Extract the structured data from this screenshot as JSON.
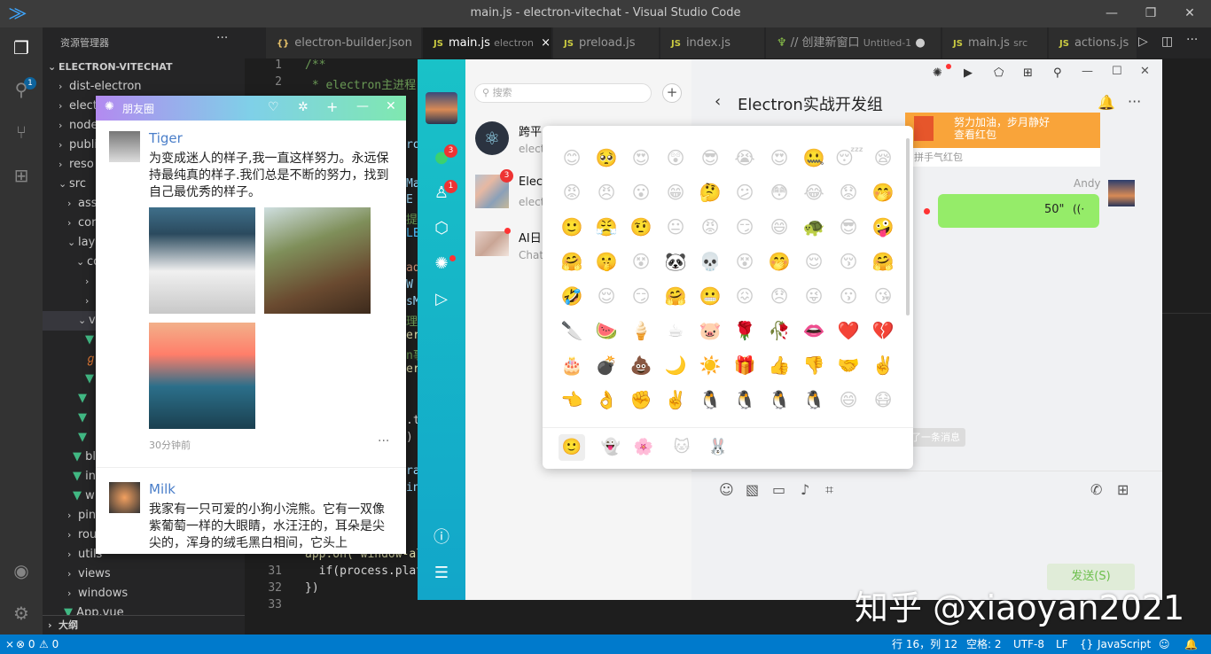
{
  "window": {
    "title": "main.js - electron-vitechat - Visual Studio Code"
  },
  "explorer": {
    "header": "资源管理器",
    "more": "···",
    "project": "ELECTRON-VITECHAT",
    "items": [
      "dist-electron",
      "elect",
      "node",
      "publi",
      "reso",
      "src",
      "ass",
      "cor",
      "layo",
      "co",
      "w",
      "s",
      "v",
      "bl",
      "in",
      "w",
      "pin",
      "rou",
      "utils",
      "views",
      "windows",
      "App.vue"
    ],
    "outline": "大纲"
  },
  "activity": {
    "badge": "1"
  },
  "tabs": [
    {
      "icon": "{}",
      "label": "electron-builder.json",
      "sub": ""
    },
    {
      "icon": "JS",
      "label": "main.js",
      "sub": "electron",
      "close": "×"
    },
    {
      "icon": "JS",
      "label": "preload.js",
      "sub": ""
    },
    {
      "icon": "JS",
      "label": "index.js",
      "sub": ""
    },
    {
      "icon": "",
      "label": "// 创建新窗口",
      "sub": "Untitled-1"
    },
    {
      "icon": "JS",
      "label": "main.js",
      "sub": "src"
    },
    {
      "icon": "JS",
      "label": "actions.js",
      "sub": ""
    }
  ],
  "code": {
    "lines": [
      {
        "n": "1",
        "t": "/**"
      },
      {
        "n": "2",
        "t": " * electron主进程"
      },
      {
        "n": "31",
        "t": "  if(process.plat"
      },
      {
        "n": "32",
        "t": "})"
      },
      {
        "n": "33",
        "t": ""
      }
    ],
    "fragments": [
      "app.on('window-al",
      "ro",
      "Ma",
      "E",
      "提示",
      "LEC",
      "ado",
      "W",
      "sM",
      "理",
      "er",
      "n事",
      "er(",
      ".t",
      ")",
      "ra",
      "in"
    ]
  },
  "status": {
    "errors": "0",
    "warnings": "0",
    "position": "行 16，列 12",
    "spaces": "空格: 2",
    "encoding": "UTF-8",
    "eol": "LF",
    "language": "JavaScript"
  },
  "moments": {
    "title": "朋友圈",
    "posts": [
      {
        "name": "Tiger",
        "text": "为变成迷人的样子,我一直这样努力。永远保持最纯真的样子.我们总是不断的努力，找到自己最优秀的样子。",
        "time": "30分钟前",
        "more": "···"
      },
      {
        "name": "Milk",
        "text": "我家有一只可爱的小狗小浣熊。它有一双像紫葡萄一样的大眼睛，水汪汪的，耳朵是尖尖的，浑身的绒毛黑白相间，它头上"
      }
    ]
  },
  "chat": {
    "search_placeholder": "搜索",
    "add": "+",
    "nav_badges": [
      "3",
      "1"
    ],
    "conversations": [
      {
        "name": "跨平",
        "preview": "elect",
        "badge": ""
      },
      {
        "name": "Elec",
        "preview": "elect",
        "badge": "3"
      },
      {
        "name": "AI日",
        "preview": "Chat",
        "badge": ""
      }
    ],
    "title": "Electron实战开发组",
    "redpacket_text": "努力加油，步月静好",
    "redpacket_link": "查看红包",
    "redpacket_footer": "拼手气红包",
    "sender": "Andy",
    "voice_duration": "50\"",
    "recall_notice": "撤回了一条消息",
    "send_button": "发送(S)"
  },
  "emoji": {
    "grid": [
      "😊",
      "🥺",
      "😍",
      "😲",
      "😎",
      "😭",
      "😍",
      "🤐",
      "😴",
      "😪",
      "😡",
      "😠",
      "😮",
      "😁",
      "🤔",
      "😕",
      "😳",
      "😂",
      "😟",
      "🤭",
      "🙂",
      "😤",
      "🤨",
      "😐",
      "😡",
      "😏",
      "😄",
      "🐢",
      "😎",
      "🤪",
      "🤗",
      "🤫",
      "😵",
      "🐼",
      "💀",
      "😵",
      "🤭",
      "😌",
      "😚",
      "🤗",
      "🤣",
      "😌",
      "😏",
      "🤗",
      "😬",
      "😖",
      "😞",
      "😜",
      "😗",
      "😘",
      "🔪",
      "🍉",
      "🍦",
      "☕",
      "🐷",
      "🌹",
      "🥀",
      "👄",
      "❤️",
      "💔",
      "🎂",
      "💣",
      "💩",
      "🌙",
      "☀️",
      "🎁",
      "👍",
      "👎",
      "🤝",
      "✌️",
      "👈",
      "👌",
      "✊",
      "✌️",
      "🐧",
      "🐧",
      "🐧",
      "🐧",
      "😄",
      "😷"
    ],
    "tabs": [
      "🙂",
      "👻",
      "🌸",
      "🐱",
      "🐰"
    ]
  },
  "watermark": "知乎 @xiaoyan2021"
}
